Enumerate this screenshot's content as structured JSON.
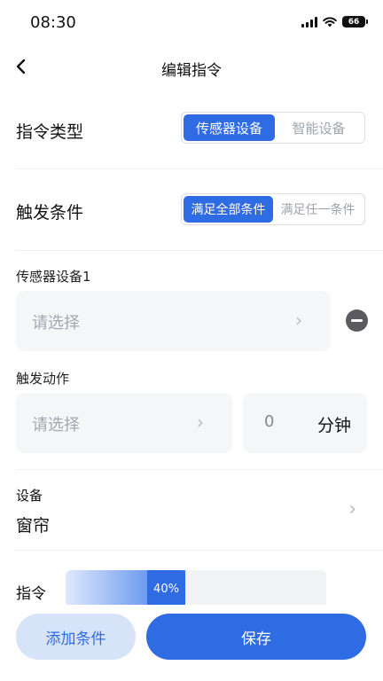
{
  "status_bar": {
    "time": "08:30",
    "battery": "66"
  },
  "nav": {
    "title": "编辑指令"
  },
  "command_type": {
    "label": "指令类型",
    "options": [
      "传感器设备",
      "智能设备"
    ],
    "selected": "传感器设备"
  },
  "trigger_condition": {
    "label": "触发条件",
    "options": [
      "满足全部条件",
      "满足任一条件"
    ],
    "selected": "满足全部条件"
  },
  "sensor": {
    "label": "传感器设备1",
    "placeholder": "请选择"
  },
  "action": {
    "label": "触发动作",
    "placeholder": "请选择",
    "minutes_value": "0",
    "minutes_unit": "分钟"
  },
  "device": {
    "label": "设备",
    "value": "窗帘"
  },
  "command": {
    "label": "指令",
    "level_percent": 40,
    "level_text": "40%"
  },
  "footer": {
    "add_label": "添加条件",
    "save_label": "保存"
  },
  "colors": {
    "accent": "#2f6be3",
    "accent_light": "#d6e3f9"
  }
}
